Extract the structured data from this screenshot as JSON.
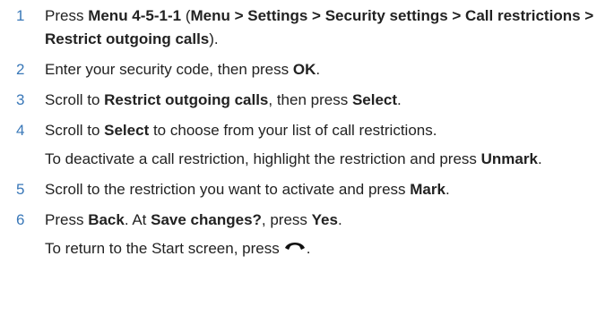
{
  "steps": [
    {
      "number": "1",
      "parts": [
        "Press ",
        "Menu 4-5-1-1",
        " (",
        "Menu > Settings > Security settings > Call restrictions > Restrict outgoing calls",
        ")."
      ]
    },
    {
      "number": "2",
      "parts": [
        "Enter your security code, then press ",
        "OK",
        "."
      ]
    },
    {
      "number": "3",
      "parts": [
        "Scroll to ",
        "Restrict outgoing calls",
        ", then press ",
        "Select",
        "."
      ]
    },
    {
      "number": "4",
      "parts": [
        "Scroll to ",
        "Select",
        " to choose from your list of call restrictions."
      ],
      "note": [
        "To deactivate a call restriction, highlight the restriction and press ",
        "Unmark",
        "."
      ]
    },
    {
      "number": "5",
      "parts": [
        "Scroll to the restriction you want to activate and press ",
        "Mark",
        "."
      ]
    },
    {
      "number": "6",
      "parts": [
        "Press ",
        "Back",
        ". At ",
        "Save changes?",
        ", press ",
        "Yes",
        "."
      ],
      "note": [
        "To return to the Start screen, press",
        "."
      ]
    }
  ],
  "icons": {
    "end_key": "end-call-key-icon"
  },
  "colors": {
    "step_number": "#3a78b8",
    "text": "#222222"
  }
}
